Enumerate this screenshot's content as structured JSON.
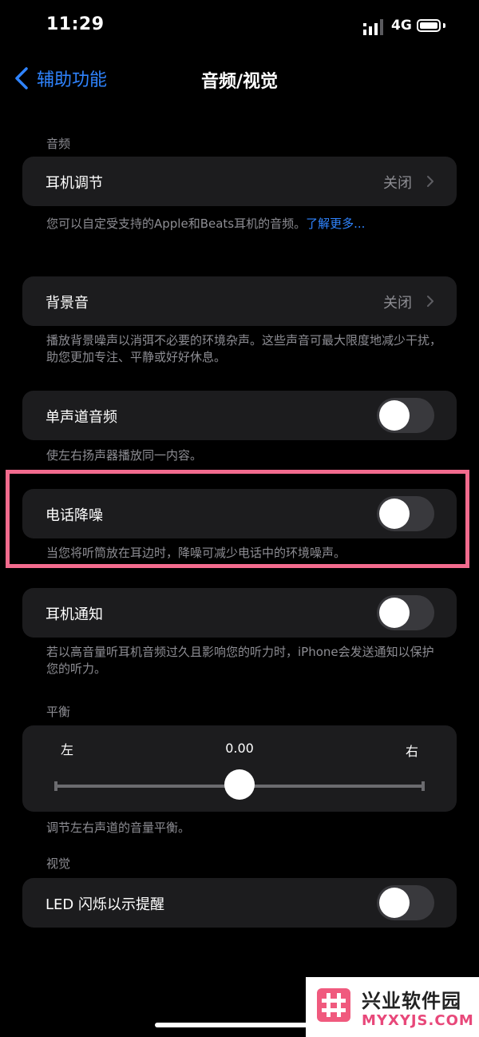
{
  "status_bar": {
    "time": "11:29",
    "network": "4G"
  },
  "nav": {
    "back_label": "辅助功能",
    "title": "音频/视觉"
  },
  "audio_section": {
    "header": "音频"
  },
  "headphone_accommodations": {
    "label": "耳机调节",
    "value": "关闭",
    "footer": "您可以自定受支持的Apple和Beats耳机的音频。",
    "link": "了解更多..."
  },
  "background_sounds": {
    "label": "背景音",
    "value": "关闭",
    "footer": "播放背景噪声以消弭不必要的环境杂声。这些声音可最大限度地减少干扰，助您更加专注、平静或好好休息。"
  },
  "mono_audio": {
    "label": "单声道音频",
    "on": false,
    "footer": "使左右扬声器播放同一内容。"
  },
  "phone_noise_cancellation": {
    "label": "电话降噪",
    "on": false,
    "footer": "当您将听筒放在耳边时，降噪可减少电话中的环境噪声。"
  },
  "headphone_notifications": {
    "label": "耳机通知",
    "on": false,
    "footer": "若以高音量听耳机音频过久且影响您的听力时，iPhone会发送通知以保护您的听力。"
  },
  "balance": {
    "header": "平衡",
    "left_label": "左",
    "right_label": "右",
    "value_text": "0.00",
    "value": 0.0,
    "footer": "调节左右声道的音量平衡。"
  },
  "visual_section": {
    "header": "视觉"
  },
  "led_flash": {
    "label": "LED 闪烁以示提醒",
    "on": false
  },
  "watermark": {
    "name": "兴业软件园",
    "url": "MYXYJS.COM"
  },
  "colors": {
    "accent": "#2f84ff",
    "highlight": "#f26b8e",
    "group_bg": "#1c1c1e",
    "secondary_text": "#8d8d93"
  }
}
